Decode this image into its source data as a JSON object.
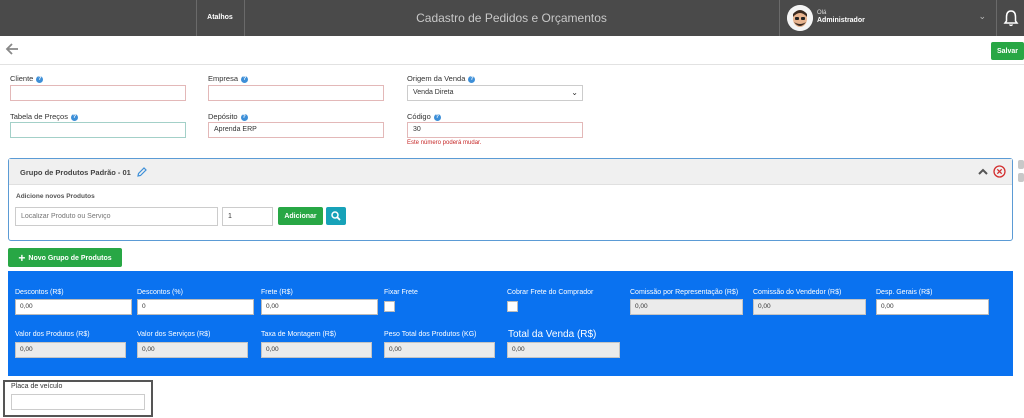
{
  "topbar": {
    "atalhos": "Atalhos",
    "title": "Cadastro de Pedidos e Orçamentos",
    "user_greeting": "Olá",
    "user_name": "Administrador"
  },
  "toolbar": {
    "save_label": "Salvar"
  },
  "form": {
    "cliente": {
      "label": "Cliente",
      "value": ""
    },
    "empresa": {
      "label": "Empresa",
      "value": ""
    },
    "origem": {
      "label": "Origem da Venda",
      "value": "Venda Direta"
    },
    "tabela": {
      "label": "Tabela de Preços",
      "value": ""
    },
    "deposito": {
      "label": "Depósito",
      "value": "Aprenda ERP"
    },
    "codigo": {
      "label": "Código",
      "value": "30",
      "note": "Este número poderá mudar."
    }
  },
  "group": {
    "title": "Grupo de Produtos Padrão - 01",
    "add_label": "Adicione novos Produtos",
    "search_placeholder": "Localizar Produto ou Serviço",
    "quantity": "1",
    "add_button": "Adicionar"
  },
  "new_group_button": "Novo Grupo de Produtos",
  "totals": {
    "descontos_rs": {
      "label": "Descontos (R$)",
      "value": "0,00"
    },
    "descontos_pct": {
      "label": "Descontos (%)",
      "value": "0"
    },
    "frete": {
      "label": "Frete (R$)",
      "value": "0,00"
    },
    "fixar_frete": {
      "label": "Fixar Frete"
    },
    "cobrar_frete": {
      "label": "Cobrar Frete do Comprador"
    },
    "comissao_rep": {
      "label": "Comissão por Representação (R$)",
      "value": "0,00"
    },
    "comissao_vend": {
      "label": "Comissão do Vendedor (R$)",
      "value": "0,00"
    },
    "desp_gerais": {
      "label": "Desp. Gerais (R$)",
      "value": "0,00"
    },
    "valor_produtos": {
      "label": "Valor dos Produtos (R$)",
      "value": "0,00"
    },
    "valor_servicos": {
      "label": "Valor dos Serviços (R$)",
      "value": "0,00"
    },
    "taxa_montagem": {
      "label": "Taxa de Montagem (R$)",
      "value": "0,00"
    },
    "peso_total": {
      "label": "Peso Total dos Produtos (KG)",
      "value": "0,00"
    },
    "total_venda": {
      "label": "Total da Venda (R$)",
      "value": "0,00"
    }
  },
  "placa": {
    "label": "Placa de veículo",
    "value": ""
  },
  "colors": {
    "accent_green": "#28a745",
    "panel_blue": "#0a72f0",
    "topbar": "#4a4a4a",
    "teal": "#17a2b8"
  }
}
